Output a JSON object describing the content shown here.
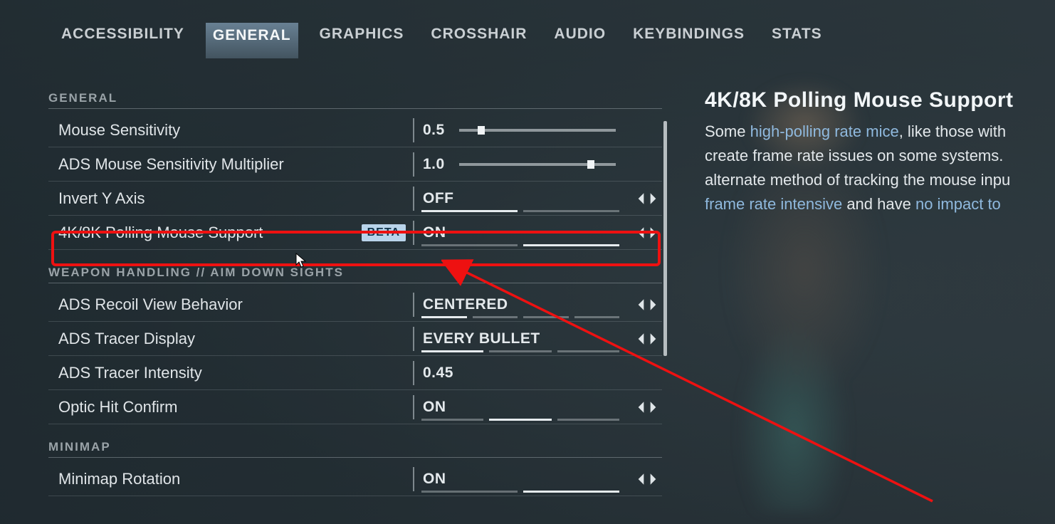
{
  "tabs": [
    {
      "label": "ACCESSIBILITY",
      "active": false
    },
    {
      "label": "GENERAL",
      "active": true
    },
    {
      "label": "GRAPHICS",
      "active": false
    },
    {
      "label": "CROSSHAIR",
      "active": false
    },
    {
      "label": "AUDIO",
      "active": false
    },
    {
      "label": "KEYBINDINGS",
      "active": false
    },
    {
      "label": "STATS",
      "active": false
    }
  ],
  "sections": {
    "general": {
      "title": "GENERAL",
      "rows": {
        "mouse_sensitivity": {
          "label": "Mouse Sensitivity",
          "value": "0.5",
          "slider_pct": 12
        },
        "ads_mult": {
          "label": "ADS Mouse Sensitivity Multiplier",
          "value": "1.0",
          "slider_pct": 82
        },
        "invert_y": {
          "label": "Invert Y Axis",
          "value": "OFF",
          "segments": [
            true,
            false
          ]
        },
        "polling": {
          "label": "4K/8K Polling Mouse Support",
          "badge": "BETA",
          "value": "ON",
          "segments": [
            false,
            true
          ]
        }
      }
    },
    "weapon": {
      "title": "WEAPON HANDLING // AIM DOWN SIGHTS",
      "rows": {
        "recoil": {
          "label": "ADS Recoil View Behavior",
          "value": "CENTERED",
          "segments": [
            true,
            false,
            false,
            false
          ]
        },
        "tracer_disp": {
          "label": "ADS Tracer Display",
          "value": "EVERY BULLET",
          "segments": [
            true,
            false,
            false
          ]
        },
        "tracer_int": {
          "label": "ADS Tracer Intensity",
          "value": "0.45",
          "slider_pct": null
        },
        "optic": {
          "label": "Optic Hit Confirm",
          "value": "ON",
          "segments": [
            false,
            true,
            false
          ]
        }
      }
    },
    "minimap": {
      "title": "MINIMAP",
      "rows": {
        "rotation": {
          "label": "Minimap Rotation",
          "value": "ON",
          "segments": [
            false,
            true
          ]
        }
      }
    }
  },
  "info": {
    "title": "4K/8K Polling Mouse Support",
    "text_parts": {
      "p1a": "Some ",
      "p1b_hl": "high-polling rate mice",
      "p1c": ", like those with",
      "p2": " create frame rate issues on some systems. ",
      "p3": " alternate method of tracking the mouse inpu",
      "p4a_hl": "frame rate intensive",
      "p4b": " and have ",
      "p4c_hl": "no impact to"
    }
  }
}
